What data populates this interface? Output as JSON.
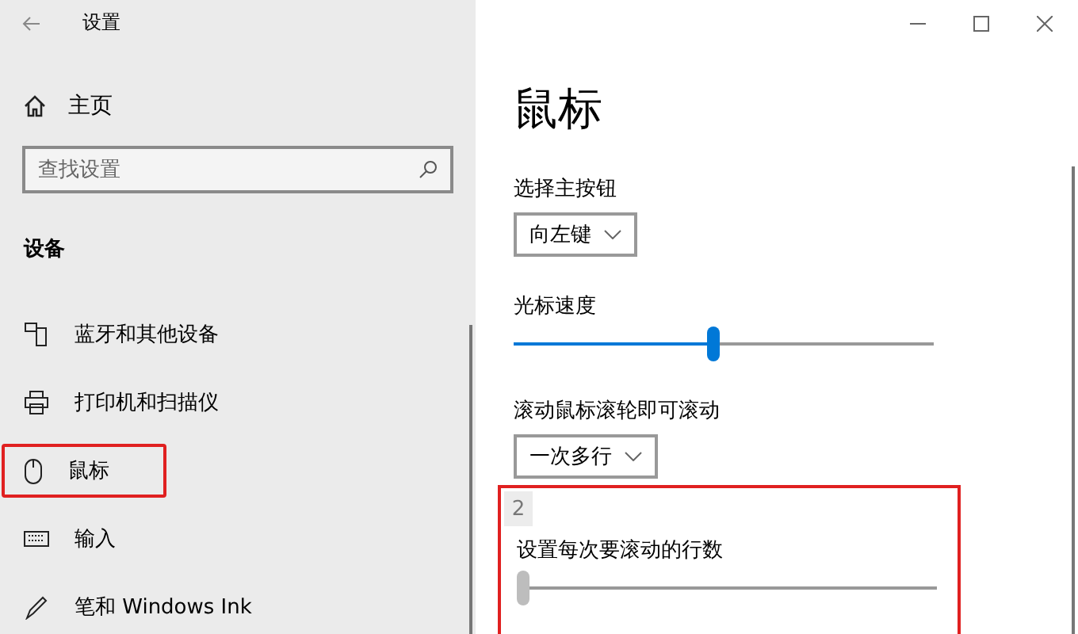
{
  "window": {
    "title": "设置"
  },
  "sidebar": {
    "home": "主页",
    "search": {
      "placeholder": "查找设置"
    },
    "section": "设备",
    "items": [
      {
        "label": "蓝牙和其他设备",
        "highlighted": false
      },
      {
        "label": "打印机和扫描仪",
        "highlighted": false
      },
      {
        "label": "鼠标",
        "highlighted": true
      },
      {
        "label": "输入",
        "highlighted": false
      },
      {
        "label": "笔和 Windows Ink",
        "highlighted": false
      }
    ]
  },
  "page": {
    "title": "鼠标",
    "settings": [
      {
        "kind": "dropdown",
        "label": "选择主按钮",
        "value": "向左键"
      },
      {
        "kind": "slider",
        "label": "光标速度",
        "level": 0.475
      },
      {
        "kind": "dropdown",
        "label": "滚动鼠标滚轮即可滚动",
        "value": "一次多行"
      }
    ],
    "highlight_box": {
      "tooltip": "2",
      "label": "设置每次要滚动的行数",
      "level": 0.0
    }
  }
}
